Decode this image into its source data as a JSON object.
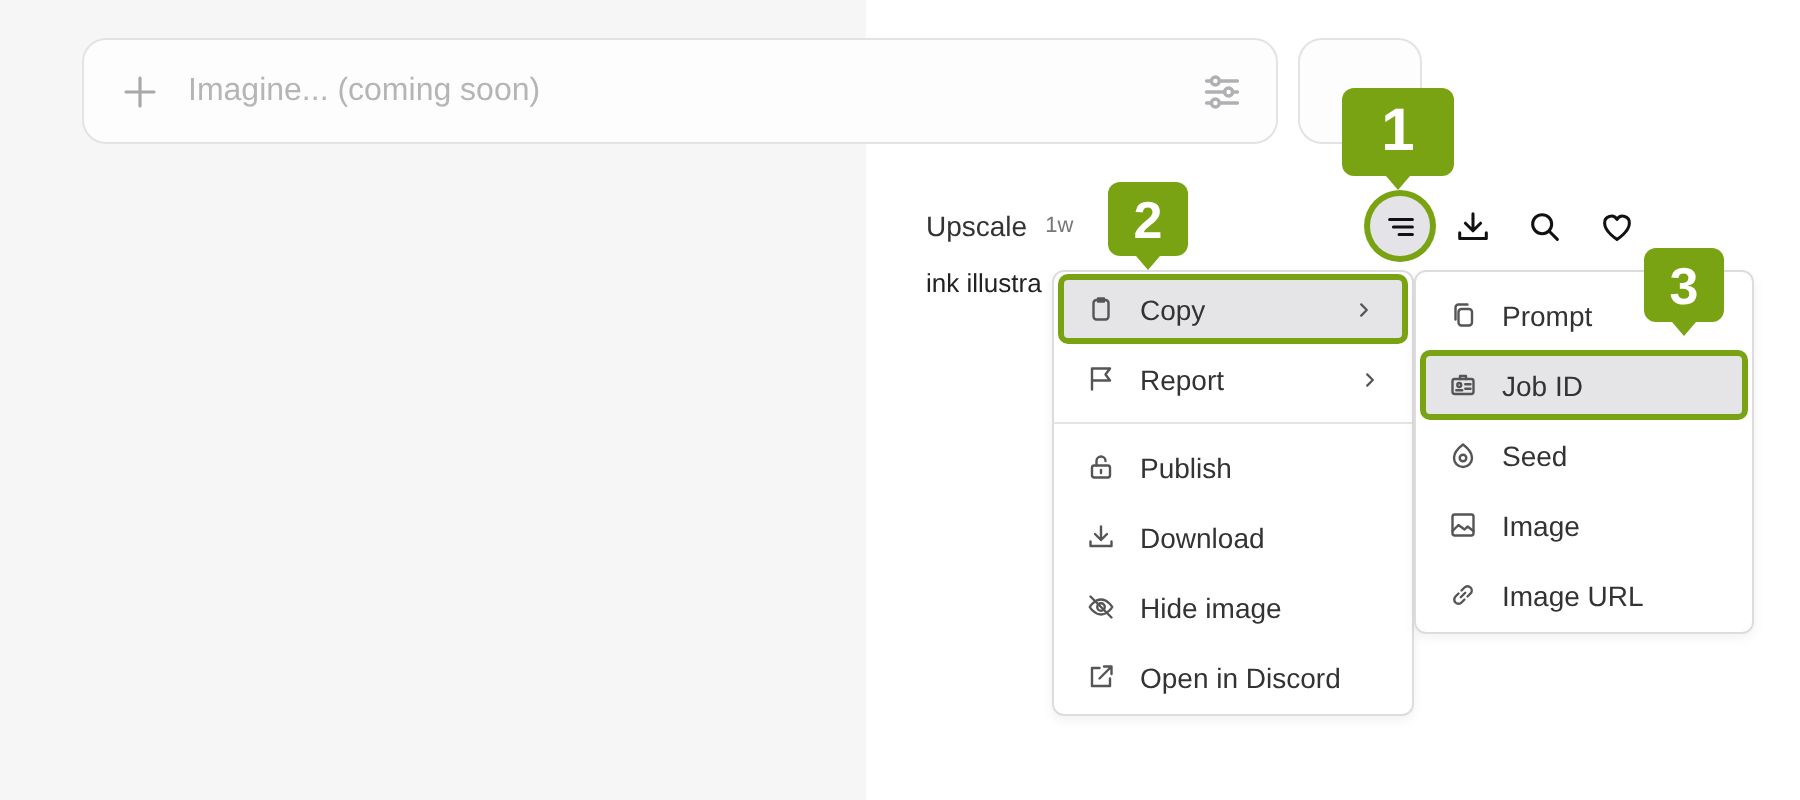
{
  "prompt_bar": {
    "placeholder": "Imagine... (coming soon)"
  },
  "job": {
    "title": "Upscale",
    "age": "1w",
    "prompt": "ink illustra"
  },
  "toolbar": [
    {
      "kind": "menu",
      "active": true
    },
    {
      "kind": "download",
      "active": false
    },
    {
      "kind": "search",
      "active": false
    },
    {
      "kind": "like",
      "active": false
    }
  ],
  "menu": {
    "items": [
      {
        "kind": "copy",
        "label": "Copy",
        "submenu": true,
        "highlighted": true
      },
      {
        "kind": "report",
        "label": "Report",
        "submenu": true,
        "highlighted": false
      },
      {
        "kind": "divider"
      },
      {
        "kind": "publish",
        "label": "Publish",
        "submenu": false,
        "highlighted": false
      },
      {
        "kind": "download",
        "label": "Download",
        "submenu": false,
        "highlighted": false
      },
      {
        "kind": "hide",
        "label": "Hide image",
        "submenu": false,
        "highlighted": false
      },
      {
        "kind": "external",
        "label": "Open in Discord",
        "submenu": false,
        "highlighted": false
      }
    ]
  },
  "submenu": {
    "items": [
      {
        "kind": "prompt",
        "label": "Prompt",
        "highlighted": false
      },
      {
        "kind": "jobid",
        "label": "Job ID",
        "highlighted": true
      },
      {
        "kind": "seed",
        "label": "Seed",
        "highlighted": false
      },
      {
        "kind": "image",
        "label": "Image",
        "highlighted": false
      },
      {
        "kind": "link",
        "label": "Image URL",
        "highlighted": false
      }
    ]
  },
  "callouts": [
    {
      "label": "1"
    },
    {
      "label": "2"
    },
    {
      "label": "3"
    }
  ]
}
